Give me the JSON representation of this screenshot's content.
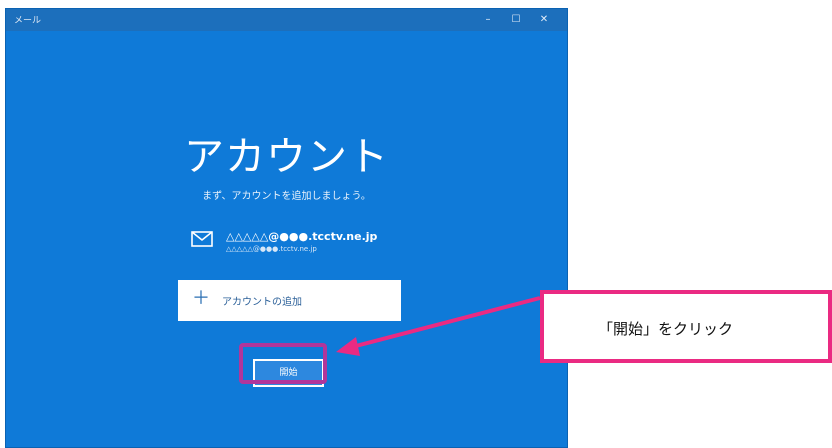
{
  "window": {
    "app_title": "メール",
    "controls": {
      "minimize": "–",
      "maximize": "☐",
      "close": "✕"
    }
  },
  "main": {
    "heading": "アカウント",
    "subtitle": "まず、アカウントを追加しましょう。",
    "account": {
      "icon": "mail-envelope-icon",
      "email_primary": "△△△△△@●●●.tcctv.ne.jp",
      "email_secondary": "△△△△△@●●●.tcctv.ne.jp"
    },
    "add_account": {
      "icon": "plus-icon",
      "label": "アカウントの追加"
    },
    "start_button_label": "開始"
  },
  "annotation": {
    "callout_text": "「開始」をクリック",
    "highlight_color": "#b0369b",
    "callout_color": "#ea2a82"
  },
  "colors": {
    "window_bg": "#0f7ad8",
    "titlebar": "#1c6fbc",
    "start_button": "#2d88df"
  }
}
